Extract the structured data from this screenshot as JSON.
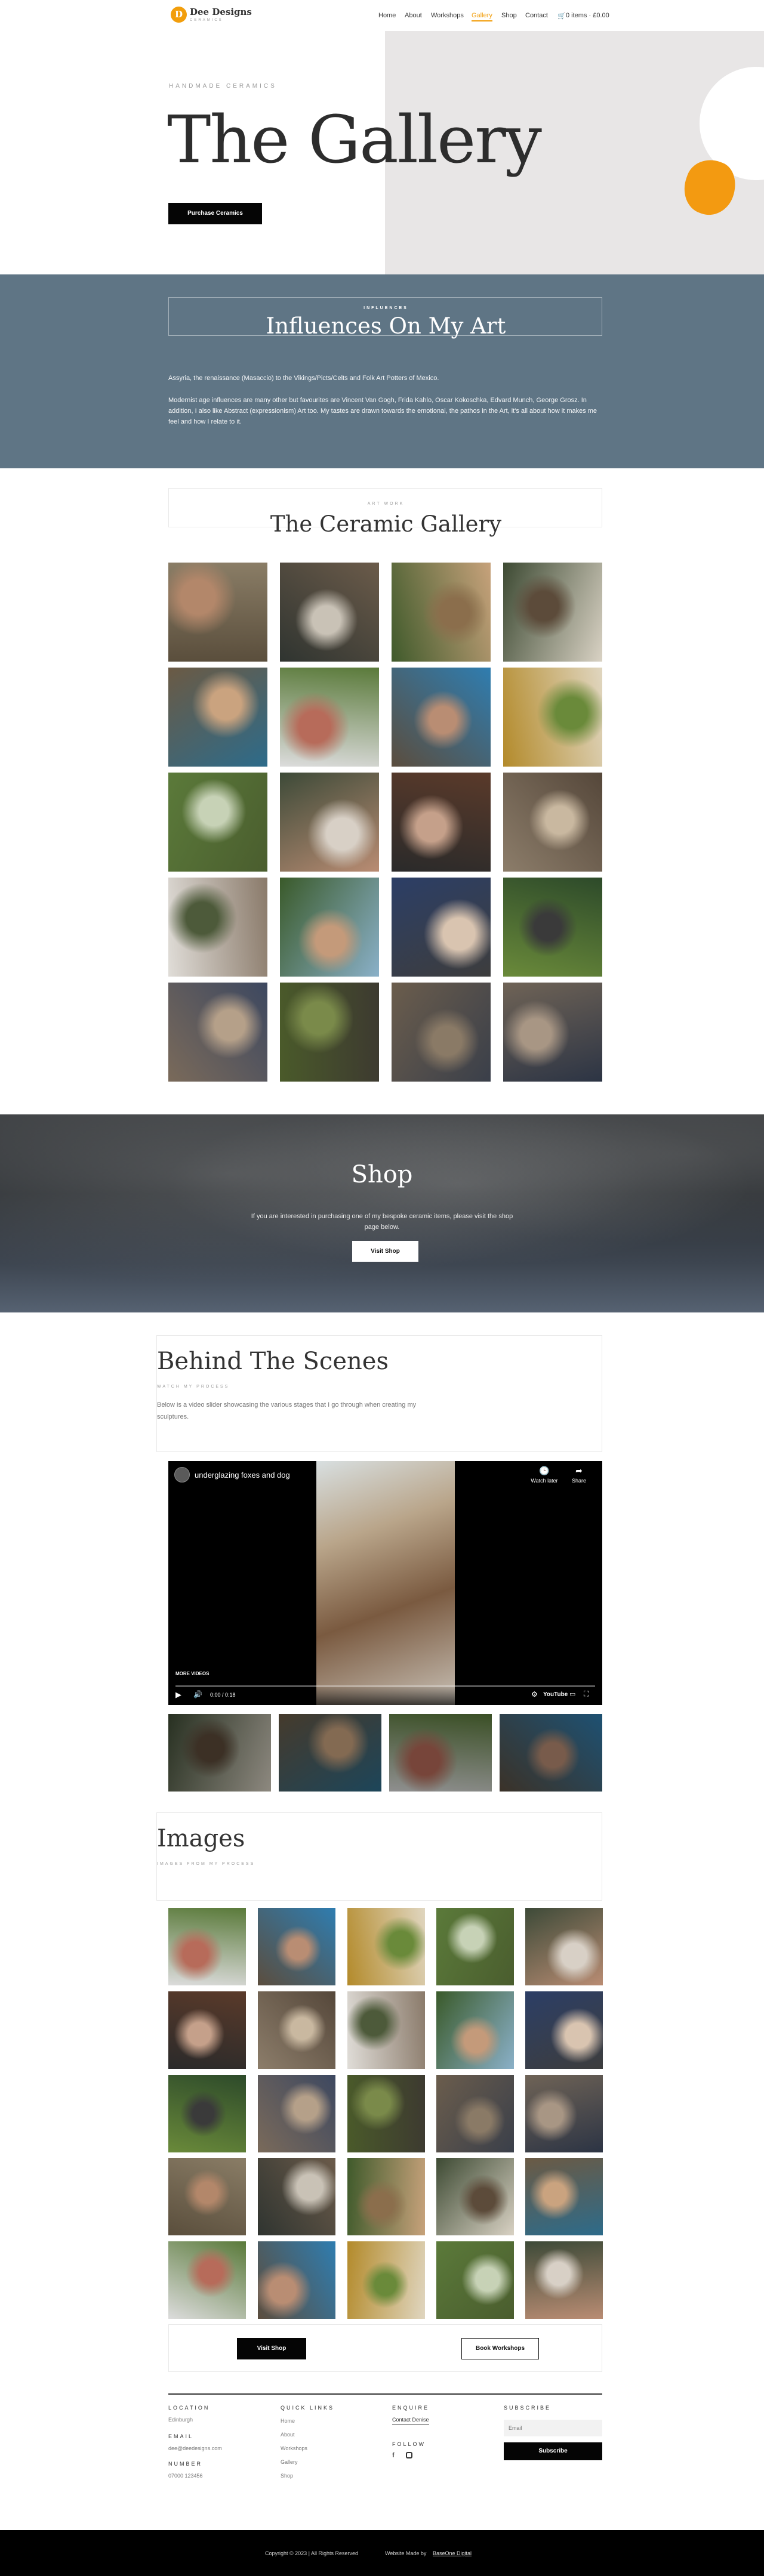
{
  "header": {
    "logo_letter": "D",
    "brand": "Dee Designs",
    "brand_sub": "CERAMICS",
    "nav": [
      "Home",
      "About",
      "Workshops",
      "Gallery",
      "Shop",
      "Contact"
    ],
    "active_nav": "Gallery",
    "cart": "0 items · £0.00"
  },
  "hero": {
    "subtitle": "HANDMADE CERAMICS",
    "title": "The Gallery",
    "button": "Purchase Ceramics"
  },
  "influences": {
    "kicker": "INFLUENCES",
    "title": "Influences On My Art",
    "line1": "Assyria, the renaissance (Masaccio) to the Vikings/Picts/Celts and Folk Art Potters of Mexico.",
    "line2": "Modernist age influences are many other but favourites are Vincent Van Gogh, Frida Kahlo, Oscar Kokoschka, Edvard Munch, George Grosz. In addition, I also like Abstract (expressionism) Art too. My tastes are drawn towards the emotional, the pathos in the Art, it's all about how it makes me feel and how I relate to it."
  },
  "gallery": {
    "kicker": "ART WORK",
    "title": "The Ceramic Gallery"
  },
  "shop": {
    "title": "Shop",
    "text": "If you are interested in purchasing one of my bespoke ceramic items, please visit the shop page below.",
    "button": "Visit Shop"
  },
  "behind": {
    "title": "Behind The Scenes",
    "kicker": "WATCH MY PROCESS",
    "text": "Below is a video slider showcasing the various stages that I go through when creating my sculptures."
  },
  "video": {
    "title": "underglazing foxes and dog",
    "watch_later": "Watch later",
    "share": "Share",
    "more_videos": "MORE VIDEOS",
    "time": "0:00 / 0:18",
    "platform": "YouTube"
  },
  "images": {
    "title": "Images",
    "kicker": "IMAGES FROM MY PROCESS"
  },
  "cta": {
    "shop_button": "Visit Shop",
    "workshops_button": "Book Workshops"
  },
  "footer": {
    "location_head": "LOCATION",
    "location": "Edinburgh",
    "email_head": "EMAIL",
    "email": "dee@deedesigns.com",
    "number_head": "NUMBER",
    "number": "07000 123456",
    "quick_head": "QUICK LINKS",
    "quick_links": [
      "Home",
      "About",
      "Workshops",
      "Gallery",
      "Shop"
    ],
    "enquire_head": "ENQUIRE",
    "enquire_link": "Contact Denise",
    "follow_head": "FOLLOW",
    "subscribe_head": "SUBSCRIBE",
    "email_placeholder": "Email",
    "subscribe_button": "Subscribe",
    "copyright": "Copyright © 2023 | All Rights Reserved",
    "made_by": "Website Made by",
    "made_by_link": "BaseOne Digital"
  },
  "colors": {
    "accent": "#f29e0c",
    "influences_bg": "#5f7585",
    "dark": "#050505"
  }
}
